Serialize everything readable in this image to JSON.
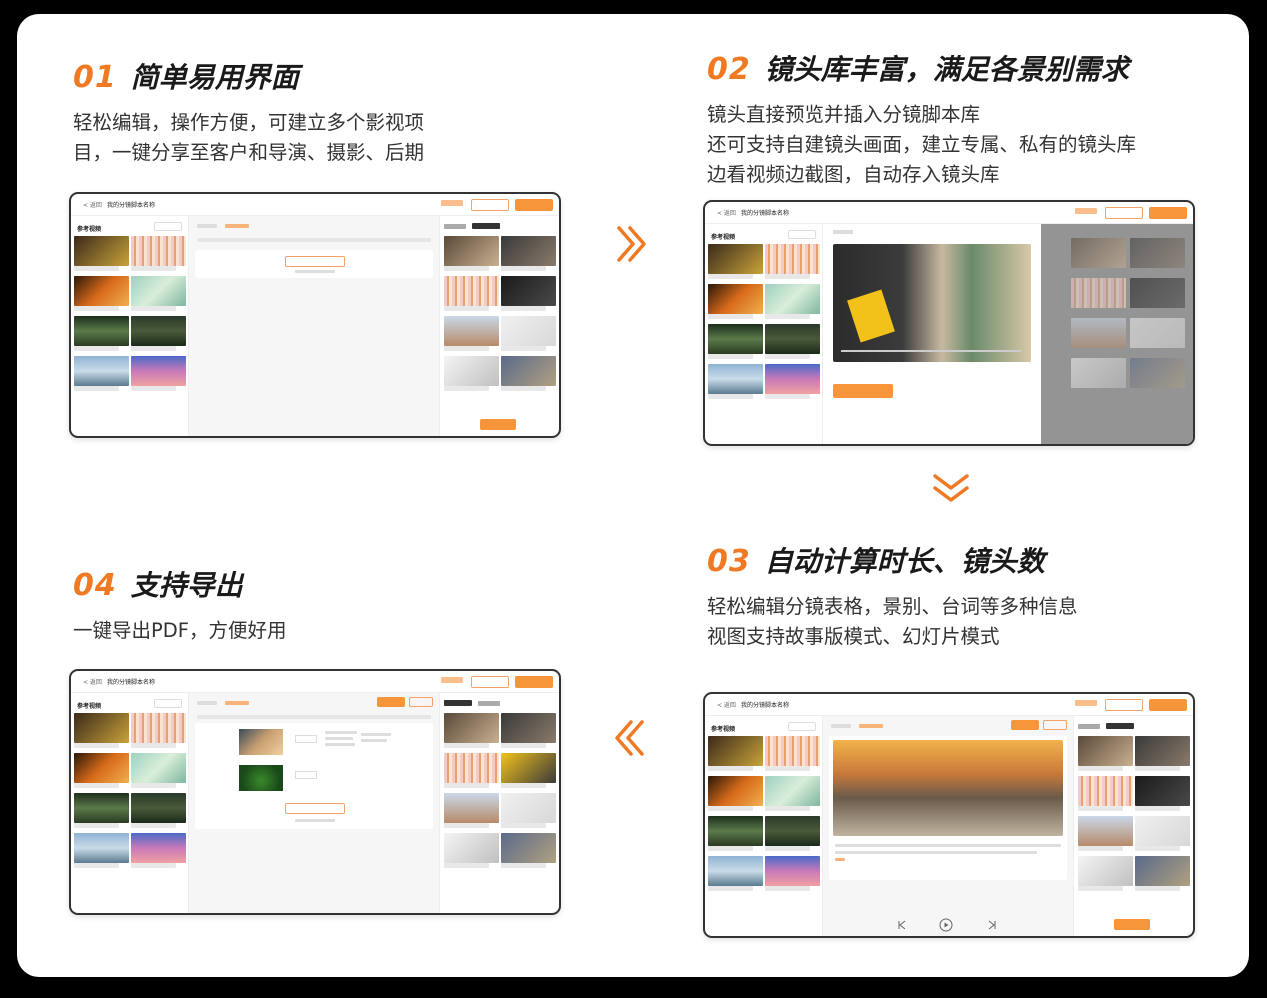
{
  "sections": [
    {
      "num": "01",
      "title": "简单易用界面",
      "lines": [
        "轻松编辑，操作方便，可建立多个影视项",
        "目，一键分享至客户和导演、摄影、后期"
      ]
    },
    {
      "num": "02",
      "title": "镜头库丰富，满足各景别需求",
      "lines": [
        "镜头直接预览并插入分镜脚本库",
        "还可支持自建镜头画面，建立专属、私有的镜头库",
        "边看视频边截图，自动存入镜头库"
      ]
    },
    {
      "num": "03",
      "title": "自动计算时长、镜头数",
      "lines": [
        "轻松编辑分镜表格，景别、台词等多种信息",
        "视图支持故事版模式、幻灯片模式"
      ]
    },
    {
      "num": "04",
      "title": "支持导出",
      "lines": [
        "一键导出PDF，方便好用"
      ]
    }
  ],
  "screens": {
    "back_label": "< 返回",
    "script_name": "我的分镜脚本名称",
    "left_panel_title": "参考视频",
    "right_tab_system": "系统镜头库",
    "right_tab_personal": "个人镜头库"
  },
  "colors": {
    "accent": "#f07a23",
    "text": "#1a1a1a",
    "body_text": "#333333"
  },
  "icons": [
    "chevron-right-double-icon",
    "chevron-down-double-icon",
    "chevron-left-double-icon"
  ]
}
